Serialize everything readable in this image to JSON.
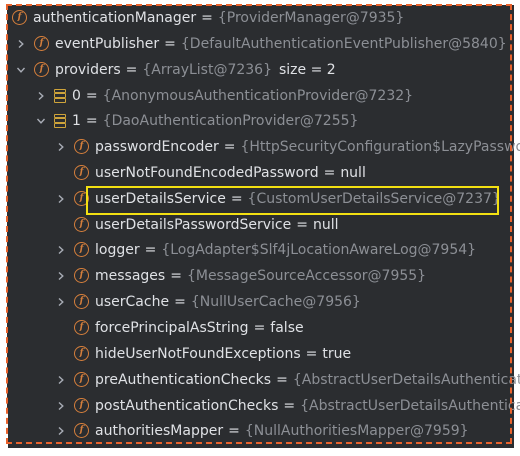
{
  "colors": {
    "panel_bg": "#2b2d30",
    "field_icon": "#d57f3c",
    "array_icon": "#cfa43a",
    "value_text": "#8c8f95",
    "highlight_box": "#f3e012",
    "dashed_border": "#e8622c"
  },
  "tree": [
    {
      "indent": 0,
      "chevron": "none",
      "icon": "field-icon",
      "name": "authenticationManager",
      "value": "{ProviderManager@7935}"
    },
    {
      "indent": 1,
      "chevron": "right",
      "icon": "field-icon",
      "name": "eventPublisher",
      "value": "{DefaultAuthenticationEventPublisher@5840}"
    },
    {
      "indent": 1,
      "chevron": "down",
      "icon": "field-icon",
      "name": "providers",
      "value": "{ArrayList@7236}",
      "extra": "size = 2"
    },
    {
      "indent": 2,
      "chevron": "right",
      "icon": "array-element-icon",
      "name": "0",
      "value": "{AnonymousAuthenticationProvider@7232}"
    },
    {
      "indent": 2,
      "chevron": "down",
      "icon": "array-element-icon",
      "name": "1",
      "value": "{DaoAuthenticationProvider@7255}"
    },
    {
      "indent": 3,
      "chevron": "right",
      "icon": "field-icon",
      "name": "passwordEncoder",
      "value": "{HttpSecurityConfiguration$LazyPasswo"
    },
    {
      "indent": 3,
      "chevron": "none",
      "icon": "field-icon",
      "name": "userNotFoundEncodedPassword",
      "plain": "null"
    },
    {
      "indent": 3,
      "chevron": "right",
      "icon": "field-icon",
      "name": "userDetailsService",
      "value": "{CustomUserDetailsService@7237}"
    },
    {
      "indent": 3,
      "chevron": "none",
      "icon": "field-icon",
      "name": "userDetailsPasswordService",
      "plain": "null"
    },
    {
      "indent": 3,
      "chevron": "right",
      "icon": "field-icon",
      "name": "logger",
      "value": "{LogAdapter$Slf4jLocationAwareLog@7954}"
    },
    {
      "indent": 3,
      "chevron": "right",
      "icon": "field-icon",
      "name": "messages",
      "value": "{MessageSourceAccessor@7955}"
    },
    {
      "indent": 3,
      "chevron": "right",
      "icon": "field-icon",
      "name": "userCache",
      "value": "{NullUserCache@7956}"
    },
    {
      "indent": 3,
      "chevron": "none",
      "icon": "field-icon",
      "name": "forcePrincipalAsString",
      "plain": "false"
    },
    {
      "indent": 3,
      "chevron": "none",
      "icon": "field-icon",
      "name": "hideUserNotFoundExceptions",
      "plain": "true"
    },
    {
      "indent": 3,
      "chevron": "right",
      "icon": "field-icon",
      "name": "preAuthenticationChecks",
      "value": "{AbstractUserDetailsAuthenticatio"
    },
    {
      "indent": 3,
      "chevron": "right",
      "icon": "field-icon",
      "name": "postAuthenticationChecks",
      "value": "{AbstractUserDetailsAuthenticat"
    },
    {
      "indent": 3,
      "chevron": "right",
      "icon": "field-icon",
      "name": "authoritiesMapper",
      "value": "{NullAuthoritiesMapper@7959}"
    }
  ],
  "icon_glyphs": {
    "field-icon": "f"
  }
}
